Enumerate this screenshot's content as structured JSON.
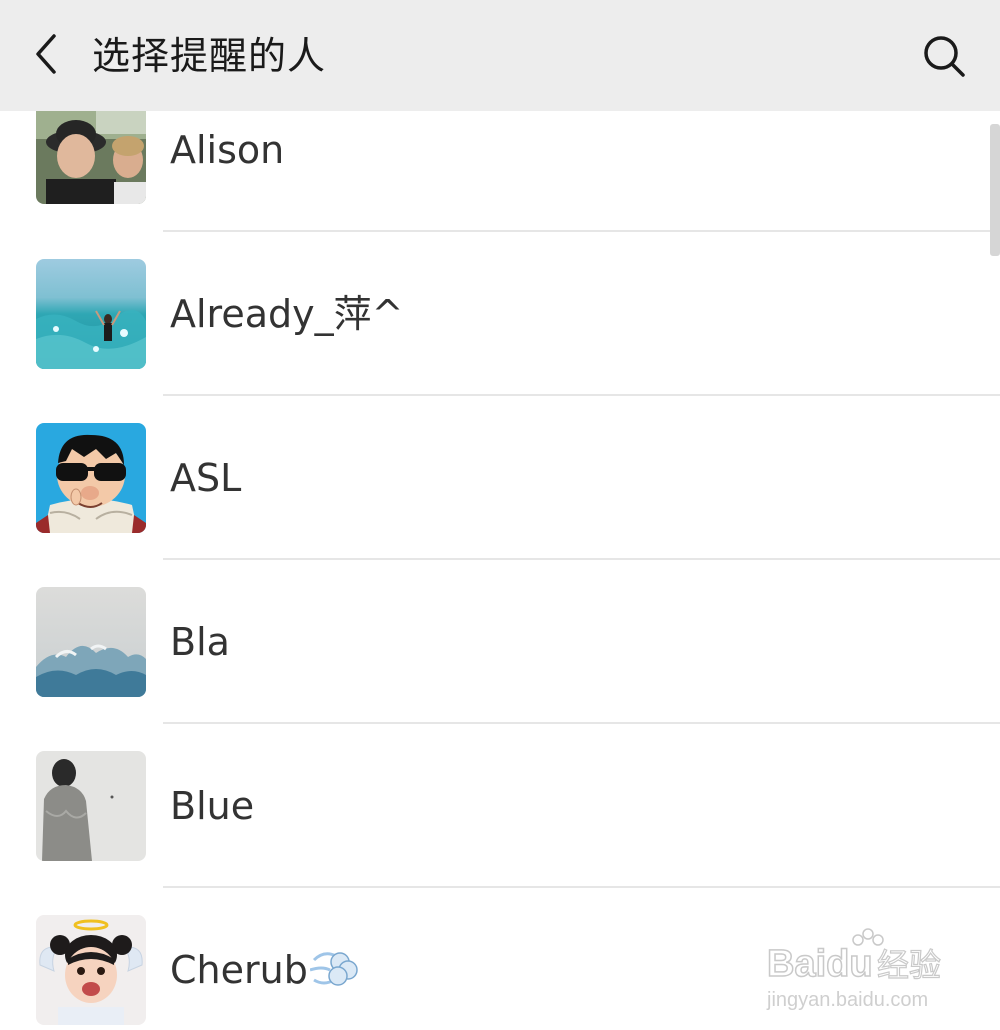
{
  "header": {
    "title": "选择提醒的人",
    "back_icon": "chevron-left-icon",
    "search_icon": "search-icon",
    "background": "#ededed"
  },
  "contacts": [
    {
      "name": "Alison",
      "avatar": "photo-two-people"
    },
    {
      "name": "Already_萍^",
      "avatar": "photo-beach-wave"
    },
    {
      "name": "ASL",
      "avatar": "cartoon-sunglasses-man"
    },
    {
      "name": "Bla",
      "avatar": "photo-ocean-wave"
    },
    {
      "name": "Blue",
      "avatar": "photo-figure-grey"
    },
    {
      "name": "Cherub",
      "avatar": "photo-child-angel",
      "suffix_icon": "dash-emoji-icon"
    }
  ],
  "watermark": {
    "brand": "Baidu",
    "suffix": "经验",
    "url": "jingyan.baidu.com"
  }
}
